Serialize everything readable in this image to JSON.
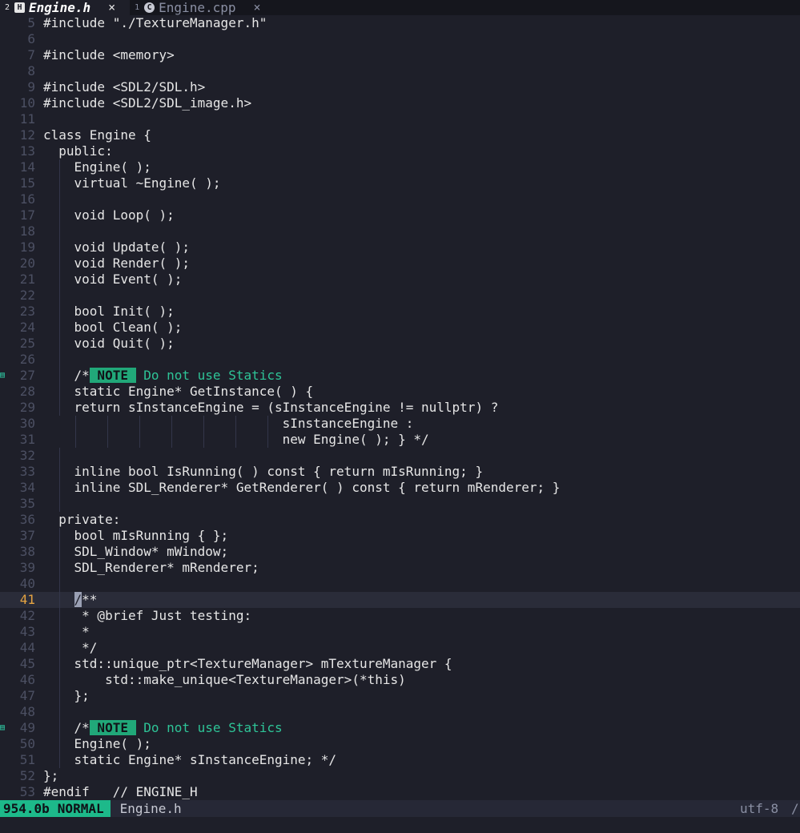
{
  "tabs": [
    {
      "number": "2",
      "icon": "H",
      "name": "Engine.h",
      "close": "×",
      "active": true
    },
    {
      "number": "1",
      "icon": "C",
      "name": "Engine.cpp",
      "close": "×",
      "active": false
    }
  ],
  "lines": [
    {
      "n": "5",
      "code": "#include \"./TextureManager.h\""
    },
    {
      "n": "6",
      "code": ""
    },
    {
      "n": "7",
      "code": "#include <memory>"
    },
    {
      "n": "8",
      "code": ""
    },
    {
      "n": "9",
      "code": "#include <SDL2/SDL.h>"
    },
    {
      "n": "10",
      "code": "#include <SDL2/SDL_image.h>"
    },
    {
      "n": "11",
      "code": ""
    },
    {
      "n": "12",
      "code": "class Engine {"
    },
    {
      "n": "13",
      "code": "  public:"
    },
    {
      "n": "14",
      "code": "    Engine( );"
    },
    {
      "n": "15",
      "code": "    virtual ~Engine( );"
    },
    {
      "n": "16",
      "code": ""
    },
    {
      "n": "17",
      "code": "    void Loop( );"
    },
    {
      "n": "18",
      "code": ""
    },
    {
      "n": "19",
      "code": "    void Update( );"
    },
    {
      "n": "20",
      "code": "    void Render( );"
    },
    {
      "n": "21",
      "code": "    void Event( );"
    },
    {
      "n": "22",
      "code": ""
    },
    {
      "n": "23",
      "code": "    bool Init( );"
    },
    {
      "n": "24",
      "code": "    bool Clean( );"
    },
    {
      "n": "25",
      "code": "    void Quit( );"
    },
    {
      "n": "26",
      "code": ""
    },
    {
      "n": "27",
      "code": "    /* NOTE  Do not use Statics",
      "note": true
    },
    {
      "n": "28",
      "code": "    static Engine* GetInstance( ) {"
    },
    {
      "n": "29",
      "code": "    return sInstanceEngine = (sInstanceEngine != nullptr) ?"
    },
    {
      "n": "30",
      "code": "                               sInstanceEngine :"
    },
    {
      "n": "31",
      "code": "                               new Engine( ); } */"
    },
    {
      "n": "32",
      "code": ""
    },
    {
      "n": "33",
      "code": "    inline bool IsRunning( ) const { return mIsRunning; }"
    },
    {
      "n": "34",
      "code": "    inline SDL_Renderer* GetRenderer( ) const { return mRenderer; }"
    },
    {
      "n": "35",
      "code": ""
    },
    {
      "n": "36",
      "code": "  private:"
    },
    {
      "n": "37",
      "code": "    bool mIsRunning { };"
    },
    {
      "n": "38",
      "code": "    SDL_Window* mWindow;"
    },
    {
      "n": "39",
      "code": "    SDL_Renderer* mRenderer;"
    },
    {
      "n": "40",
      "code": ""
    },
    {
      "n": "41",
      "code": "    /**",
      "current": true
    },
    {
      "n": "42",
      "code": "     * @brief Just testing:"
    },
    {
      "n": "43",
      "code": "     *"
    },
    {
      "n": "44",
      "code": "     */"
    },
    {
      "n": "45",
      "code": "    std::unique_ptr<TextureManager> mTextureManager {"
    },
    {
      "n": "46",
      "code": "        std::make_unique<TextureManager>(*this)"
    },
    {
      "n": "47",
      "code": "    };"
    },
    {
      "n": "48",
      "code": ""
    },
    {
      "n": "49",
      "code": "    /* NOTE  Do not use Statics",
      "note": true
    },
    {
      "n": "50",
      "code": "    Engine( );"
    },
    {
      "n": "51",
      "code": "    static Engine* sInstanceEngine; */"
    },
    {
      "n": "52",
      "code": "};"
    },
    {
      "n": "53",
      "code": "#endif   // ENGINE_H"
    }
  ],
  "note": {
    "prefix": "/*",
    "badge": " NOTE ",
    "text": " Do not use Statics"
  },
  "statusline": {
    "size": "954.0b",
    "mode": "NORMAL",
    "file": "Engine.h",
    "encoding": "utf-8",
    "more": "/"
  },
  "colors": {
    "accent": "#1db98a",
    "current_line_number": "#e5a442",
    "note_text": "#2ec497"
  }
}
